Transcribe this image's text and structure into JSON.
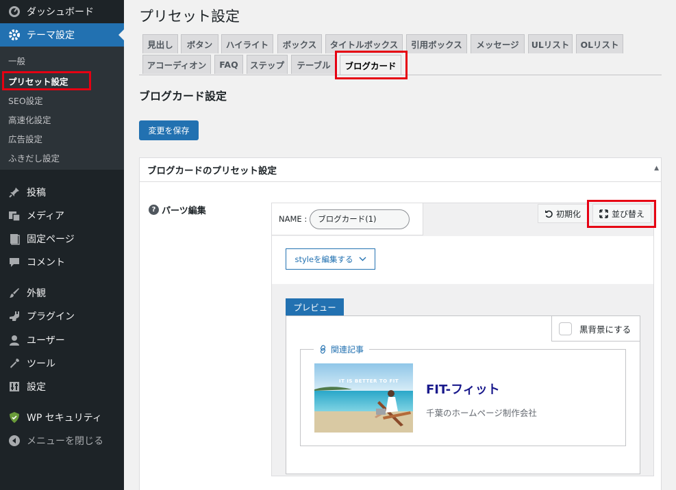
{
  "sidebar": {
    "items": [
      {
        "label": "ダッシュボード",
        "icon": "dashboard-icon"
      },
      {
        "label": "テーマ設定",
        "icon": "gear-icon"
      },
      {
        "label": "投稿",
        "icon": "pin-icon"
      },
      {
        "label": "メディア",
        "icon": "media-icon"
      },
      {
        "label": "固定ページ",
        "icon": "page-icon"
      },
      {
        "label": "コメント",
        "icon": "comment-icon"
      },
      {
        "label": "外観",
        "icon": "brush-icon"
      },
      {
        "label": "プラグイン",
        "icon": "plugin-icon"
      },
      {
        "label": "ユーザー",
        "icon": "user-icon"
      },
      {
        "label": "ツール",
        "icon": "wrench-icon"
      },
      {
        "label": "設定",
        "icon": "settings-icon"
      },
      {
        "label": "WP セキュリティ",
        "icon": "shield-icon"
      },
      {
        "label": "メニューを閉じる",
        "icon": "collapse-icon"
      }
    ],
    "submenu": [
      "一般",
      "プリセット設定",
      "SEO設定",
      "高速化設定",
      "広告設定",
      "ふきだし設定"
    ]
  },
  "page": {
    "title": "プリセット設定",
    "section_title": "ブログカード設定",
    "save_label": "変更を保存"
  },
  "tabs": {
    "row1": [
      "見出し",
      "ボタン",
      "ハイライト",
      "ボックス",
      "タイトルボックス",
      "引用ボックス",
      "メッセージ",
      "ULリスト",
      "OLリスト"
    ],
    "row2": [
      "アコーディオン",
      "FAQ",
      "ステップ",
      "テーブル",
      "ブログカード"
    ]
  },
  "card": {
    "header": "ブログカードのプリセット設定",
    "parts_label": "パーツ編集",
    "name_label": "NAME :",
    "name_value": "ブログカード(1)",
    "reset_label": "初期化",
    "sort_label": "並び替え",
    "style_label": "styleを編集する",
    "preview_label": "プレビュー",
    "dark_label": "黒背景にする",
    "related_label": "関連記事",
    "blog_title": "FIT-フィット",
    "blog_desc": "千葉のホームページ制作会社",
    "thumb_text": "IT IS BETTER TO FIT"
  },
  "colors": {
    "accent": "#2271b1",
    "sidebar_bg": "#1d2327",
    "highlight_red": "#e60012",
    "title_color": "#1a1a8c"
  }
}
